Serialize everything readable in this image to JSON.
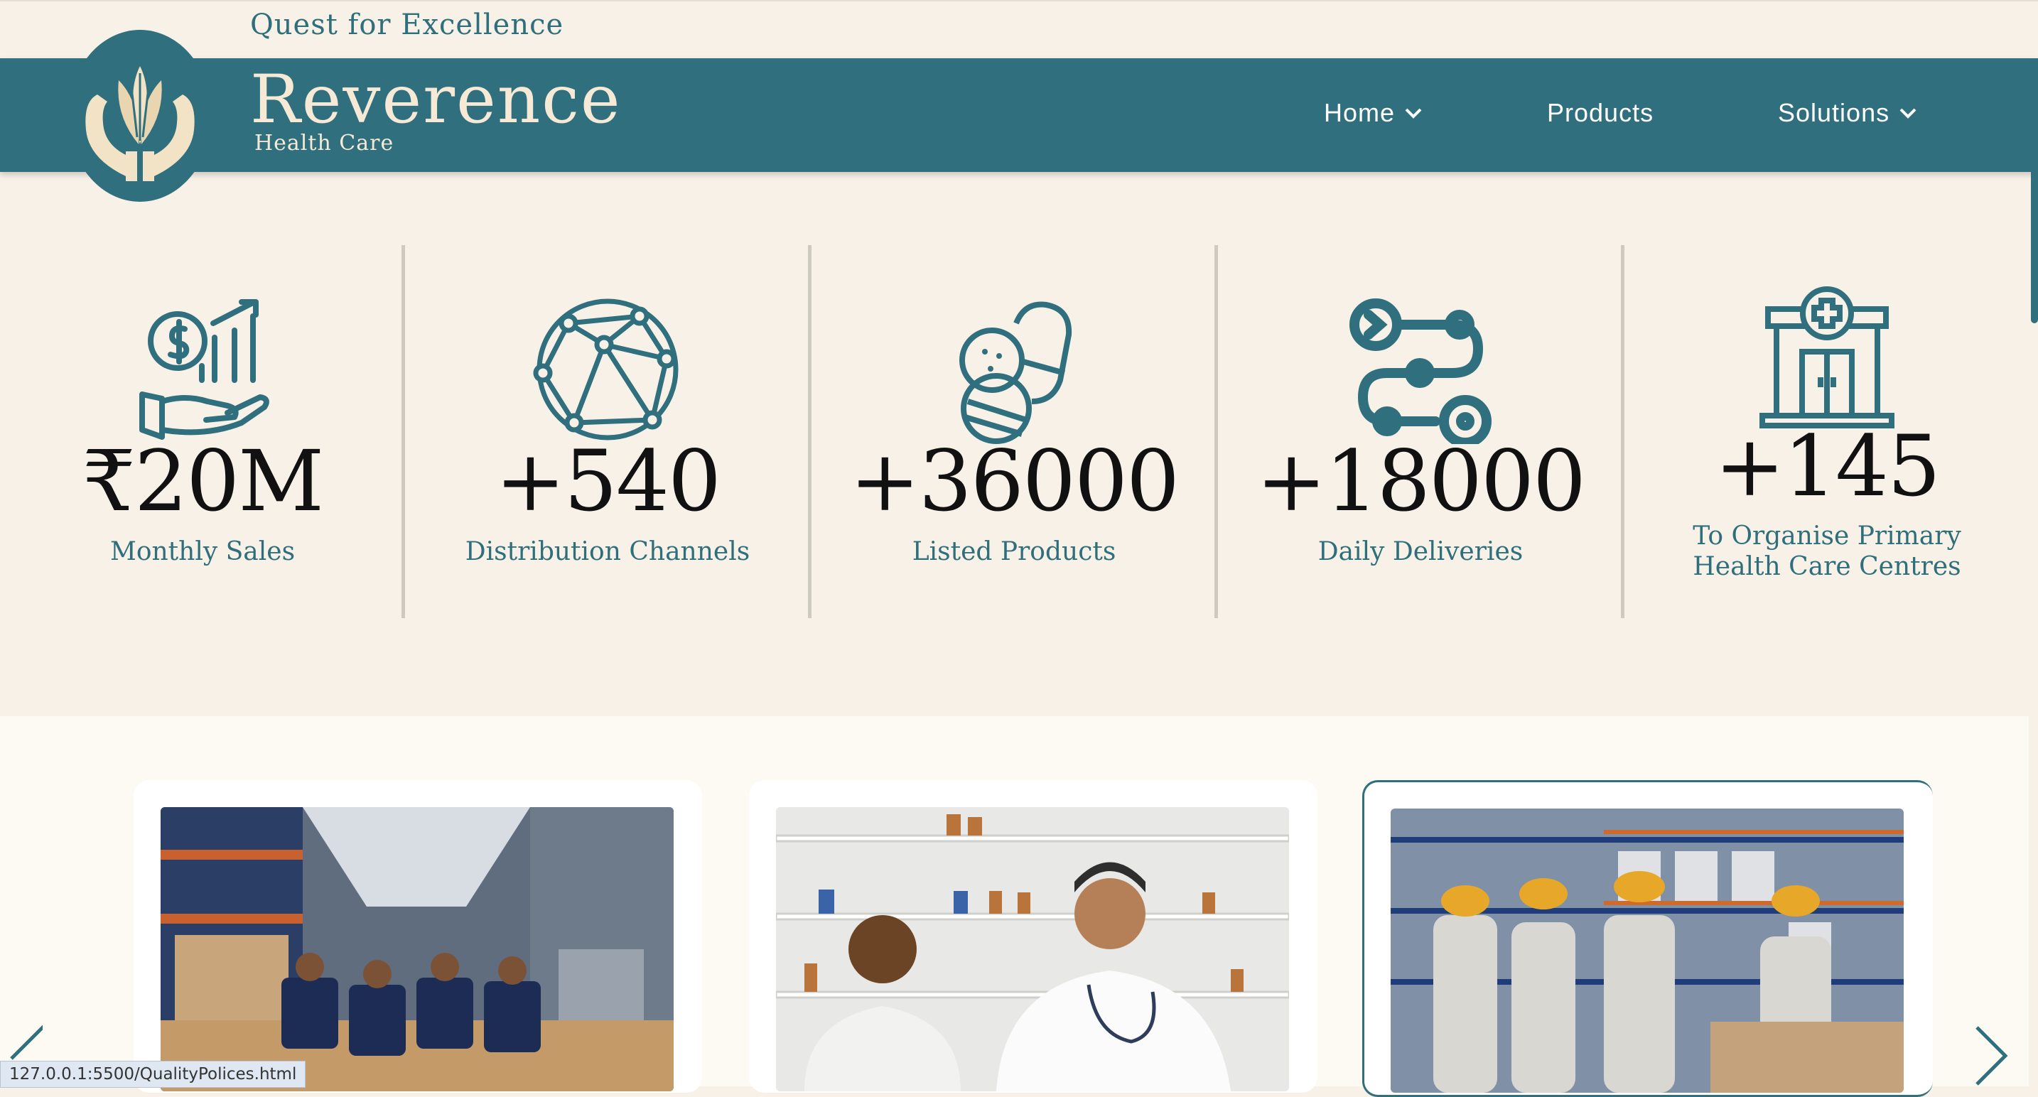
{
  "header": {
    "tagline": "Quest for Excellence",
    "brand_name": "Reverence",
    "brand_subtitle": "Health Care",
    "nav": [
      {
        "label": "Home",
        "has_dropdown": true
      },
      {
        "label": "Products",
        "has_dropdown": false
      },
      {
        "label": "Solutions",
        "has_dropdown": true
      }
    ]
  },
  "stats": [
    {
      "icon": "money-growth-hand-icon",
      "value": "₹20M",
      "label": "Monthly Sales"
    },
    {
      "icon": "network-globe-icon",
      "value": "+540",
      "label": "Distribution Channels"
    },
    {
      "icon": "pills-capsule-icon",
      "value": "+36000",
      "label": "Listed Products"
    },
    {
      "icon": "delivery-route-icon",
      "value": "+18000",
      "label": "Daily Deliveries"
    },
    {
      "icon": "health-centre-building-icon",
      "value": "+145",
      "label": "To Organise Primary Health Care Centres"
    }
  ],
  "carousel": {
    "cards": [
      {
        "photo": "warehouse-team-photo"
      },
      {
        "photo": "pharmacist-consultation-photo"
      },
      {
        "photo": "warehouse-workers-hardhats-photo"
      }
    ],
    "prev_icon": "chevron-left-icon",
    "next_icon": "chevron-right-icon"
  },
  "status_bar": {
    "url": "127.0.0.1:5500/QualityPolices.html"
  },
  "colors": {
    "brand_teal": "#306f7d",
    "background": "#f7f1e8",
    "cream": "#f6ead7"
  }
}
